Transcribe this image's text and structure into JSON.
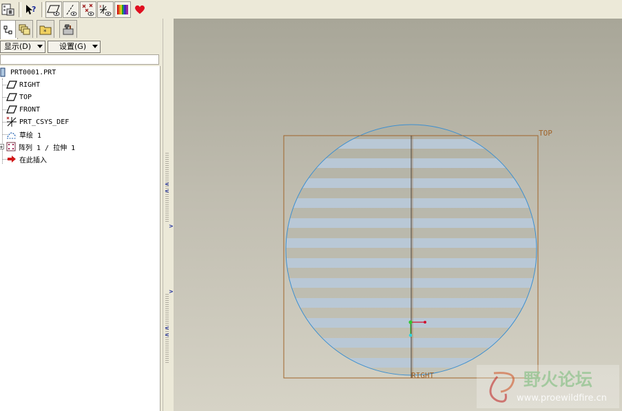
{
  "toolbar": {
    "icons": [
      "model-tree-settings-icon",
      "context-help-icon",
      "datum-plane-display-icon",
      "datum-axis-display-icon",
      "datum-point-display-icon",
      "coordinate-system-display-icon",
      "appearance-gallery-icon",
      "favorites-heart-icon"
    ]
  },
  "navigator": {
    "tabs": [
      "model-tree",
      "folder-browser",
      "favorites",
      "connections"
    ],
    "show_menu_label": "显示(D)",
    "settings_menu_label": "设置(G)",
    "tree": [
      {
        "label": "PRT0001.PRT",
        "icon": "part-icon"
      },
      {
        "label": "RIGHT",
        "icon": "datum-plane-icon"
      },
      {
        "label": "TOP",
        "icon": "datum-plane-icon"
      },
      {
        "label": "FRONT",
        "icon": "datum-plane-icon"
      },
      {
        "label": "PRT_CSYS_DEF",
        "icon": "csys-icon"
      },
      {
        "label": "草绘 1",
        "icon": "sketch-icon"
      },
      {
        "label": "阵列 1 / 拉伸 1",
        "icon": "pattern-icon"
      },
      {
        "label": "在此插入",
        "icon": "insert-here-arrow-icon"
      }
    ]
  },
  "viewport": {
    "datum_top_label": "TOP",
    "datum_right_label": "RIGHT",
    "watermark_cn": "野火论坛",
    "watermark_url": "www.proewildfire.cn"
  },
  "colors": {
    "datum": "#a0642a",
    "sketch": "#3c8fd0",
    "stripe": "#b9c8d6",
    "background": "#a8a698"
  }
}
